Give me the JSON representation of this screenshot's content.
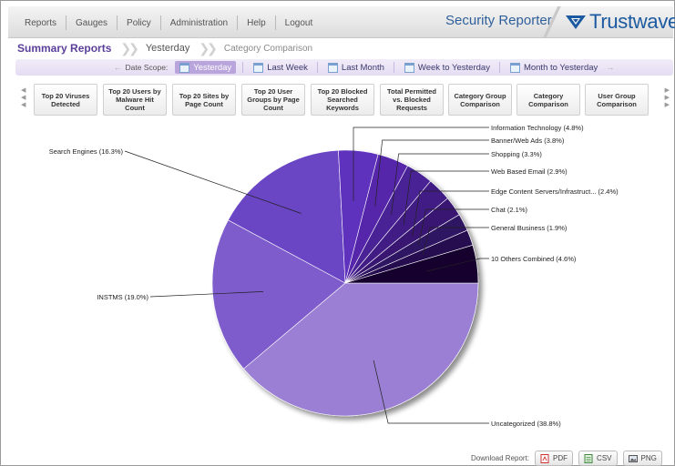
{
  "nav": {
    "items": [
      "Reports",
      "Gauges",
      "Policy",
      "Administration",
      "Help",
      "Logout"
    ]
  },
  "brand": {
    "product": "Security Reporter",
    "logo": "Trustwave",
    "logo_suffix": "®"
  },
  "breadcrumb": [
    "Summary Reports",
    "Yesterday",
    "Category Comparison"
  ],
  "date_scope": {
    "label": "Date Scope:",
    "options": [
      "Yesterday",
      "Last Week",
      "Last Month",
      "Week to Yesterday",
      "Month to Yesterday"
    ],
    "selected": "Yesterday"
  },
  "report_tiles": [
    "Top 20 Viruses Detected",
    "Top 20 Users by Malware Hit Count",
    "Top 20 Sites by Page Count",
    "Top 20 User Groups by Page Count",
    "Top 20 Blocked Searched Keywords",
    "Total Permitted vs. Blocked Requests",
    "Category Group Comparison",
    "Category Comparison",
    "User Group Comparison"
  ],
  "chart_data": {
    "type": "pie",
    "title": "",
    "slices": [
      {
        "label": "Uncategorized (38.8%)",
        "value": 38.8,
        "color": "#9a7fd4"
      },
      {
        "label": "INSTMS (19.0%)",
        "value": 19.0,
        "color": "#7e5ccc"
      },
      {
        "label": "Search Engines (16.3%)",
        "value": 16.3,
        "color": "#6a45c4"
      },
      {
        "label": "Information Technology (4.8%)",
        "value": 4.8,
        "color": "#5f32bd"
      },
      {
        "label": "Banner/Web Ads (3.8%)",
        "value": 3.8,
        "color": "#5428aa"
      },
      {
        "label": "Shopping (3.3%)",
        "value": 3.3,
        "color": "#4a2296"
      },
      {
        "label": "Web Based Email (2.9%)",
        "value": 2.9,
        "color": "#401c84"
      },
      {
        "label": "Edge Content Servers/Infrastruct... (2.4%)",
        "value": 2.4,
        "color": "#371772"
      },
      {
        "label": "Chat (2.1%)",
        "value": 2.1,
        "color": "#2e1262"
      },
      {
        "label": "General Business (1.9%)",
        "value": 1.9,
        "color": "#250d50"
      },
      {
        "label": "10 Others Combined (4.6%)",
        "value": 4.6,
        "color": "#16062e"
      }
    ]
  },
  "download": {
    "label": "Download Report:",
    "buttons": [
      "PDF",
      "CSV",
      "PNG"
    ]
  }
}
